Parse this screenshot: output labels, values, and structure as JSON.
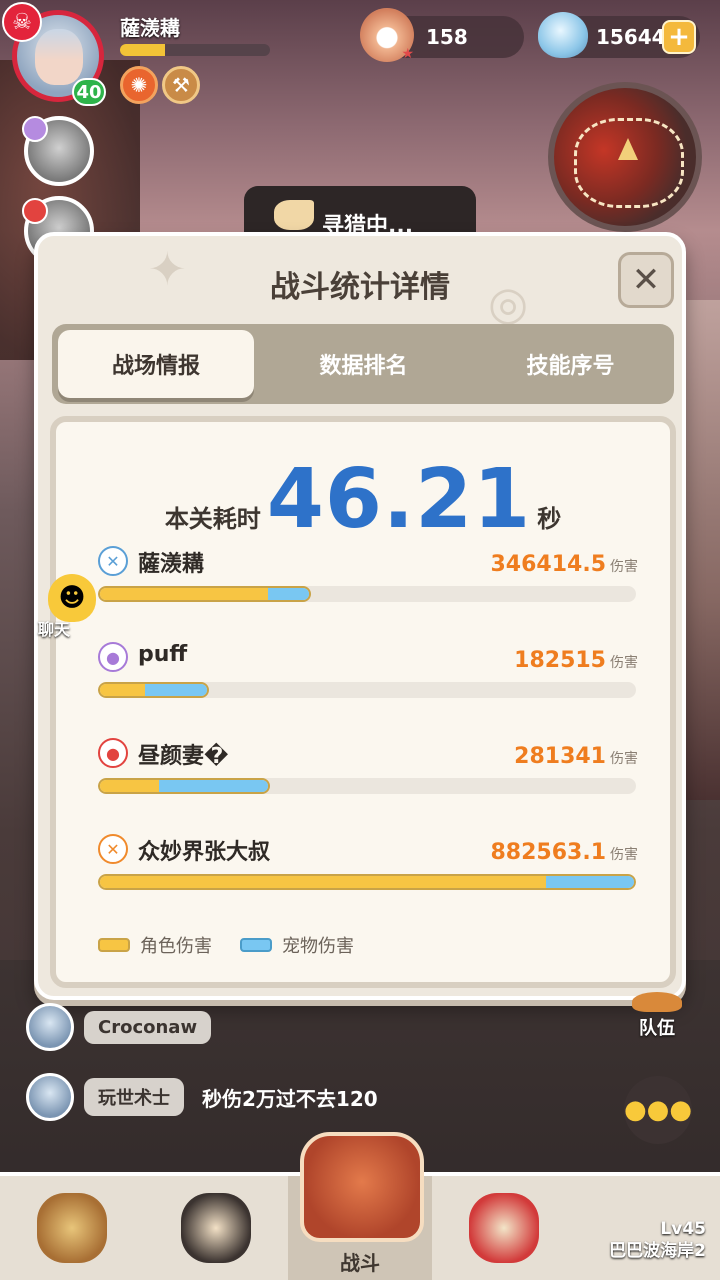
{
  "hud": {
    "player_name": "薩㵪耩",
    "level": "40",
    "hp_fraction": 0.3,
    "currency_pearl": "158",
    "currency_gem": "15644"
  },
  "hunting": {
    "label": "寻猎中..."
  },
  "dialog": {
    "title": "战斗统计详情",
    "tabs": [
      "战场情报",
      "数据排名",
      "技能序号"
    ],
    "time_label": "本关耗时",
    "time_value": "46.21",
    "time_unit": "秒",
    "damage_unit": "伤害",
    "entries": [
      {
        "name": "薩㵪耩",
        "total": "346414.5",
        "role_frac": 0.318,
        "pet_frac": 0.078,
        "icon_color": "#5a9fd6"
      },
      {
        "name": "puff",
        "total": "182515",
        "role_frac": 0.086,
        "pet_frac": 0.12,
        "icon_color": "#a77ad8"
      },
      {
        "name": "昼颜妻�",
        "total": "281341",
        "role_frac": 0.113,
        "pet_frac": 0.206,
        "icon_color": "#e2433f"
      },
      {
        "name": "众妙界张大叔",
        "total": "882563.1",
        "role_frac": 0.835,
        "pet_frac": 0.165,
        "icon_color": "#f08a2c"
      }
    ],
    "legend": {
      "role": "角色伤害",
      "pet": "宠物伤害"
    },
    "colors": {
      "role": "#f7c543",
      "pet": "#79c7f2",
      "accent": "#2e72c9",
      "damage": "#ef7d1f"
    }
  },
  "chat": {
    "label": "聊天",
    "messages": [
      {
        "name": "Croconaw",
        "text": ""
      },
      {
        "name": "玩世术士",
        "text": "秒伤2万过不去120"
      }
    ]
  },
  "side": {
    "team_label": "队伍"
  },
  "nav": {
    "battle": "战斗",
    "locked_level": "Lv45",
    "locked_name": "巴巴波海岸2"
  },
  "icons": [
    "skull-icon",
    "pearl-icon",
    "gem-icon",
    "plus-icon",
    "close-icon",
    "chat-icon",
    "lock-icon"
  ]
}
